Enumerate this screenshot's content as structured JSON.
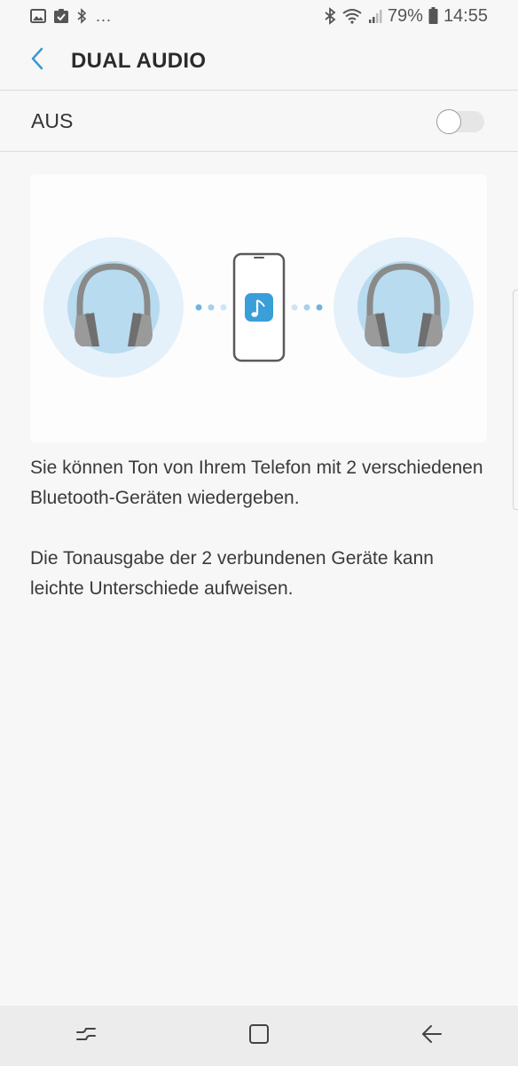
{
  "status_bar": {
    "left_icons": [
      "gallery-icon",
      "clipboard-check-icon",
      "bluetooth-icon"
    ],
    "overflow": "...",
    "right_icons": [
      "bluetooth-icon",
      "wifi-icon",
      "signal-icon",
      "battery-icon"
    ],
    "battery": "79%",
    "time": "14:55"
  },
  "header": {
    "title": "DUAL AUDIO",
    "back_icon": "chevron-left-icon"
  },
  "toggle": {
    "label": "AUS",
    "state": "off"
  },
  "illustration": {
    "icons": [
      "headphones-icon",
      "phone-icon",
      "music-note-icon",
      "headphones-icon"
    ]
  },
  "description": {
    "line1": "Sie können Ton von Ihrem Telefon mit 2 verschiedenen Bluetooth-Geräten wiedergeben.",
    "line2": "Die Tonausgabe der 2 verbundenen Geräte kann leichte Unterschiede aufweisen."
  },
  "nav_bar": {
    "buttons": [
      "recent-apps-icon",
      "home-icon",
      "back-icon"
    ]
  },
  "colors": {
    "accent": "#3a98d4",
    "circle_outer": "#e4f1fa",
    "circle_inner": "#b8dbef",
    "headphone": "#8f8f8f",
    "music_tile": "#3a9ed8"
  }
}
